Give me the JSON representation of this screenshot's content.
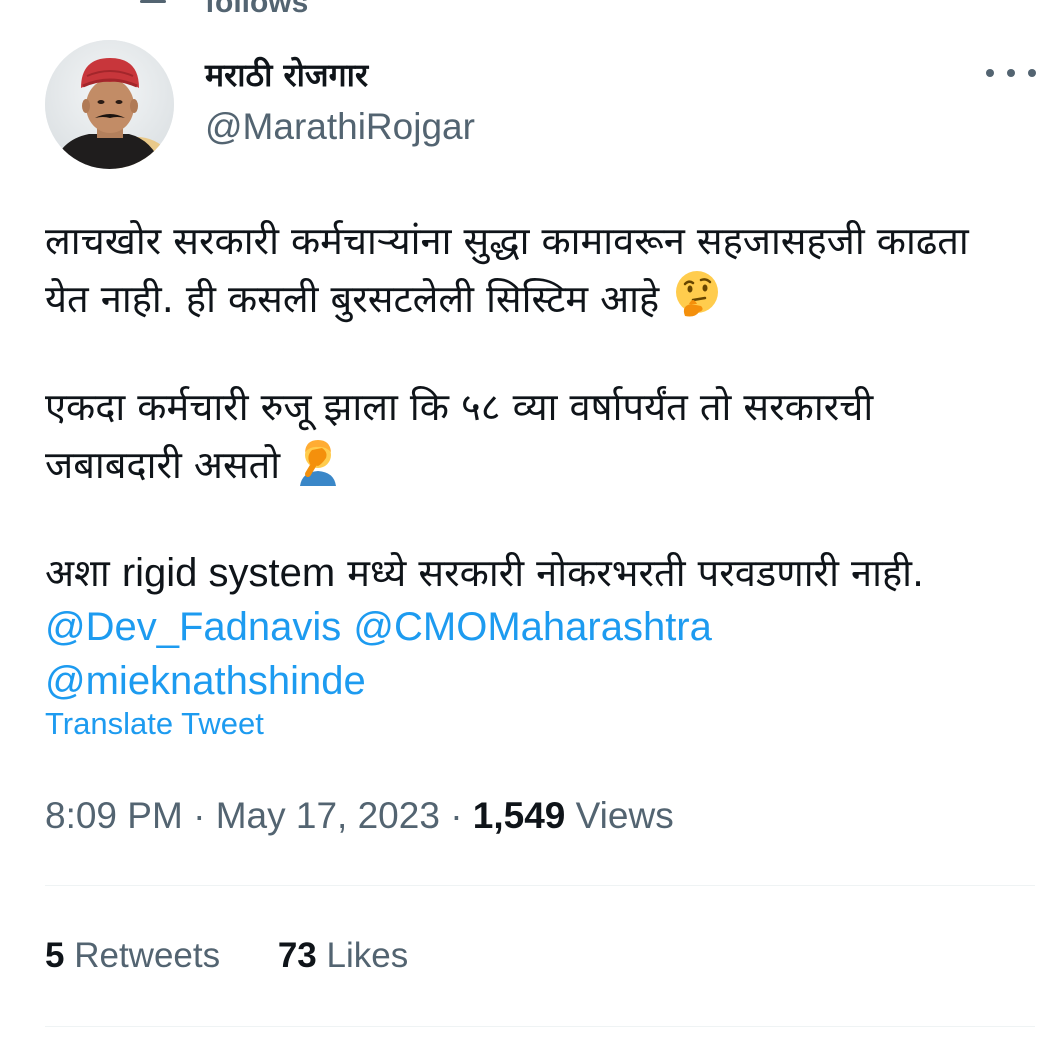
{
  "top_bar": {
    "follows_label": "follows"
  },
  "author": {
    "display_name": "मराठी रोजगार",
    "handle": "@MarathiRojgar",
    "avatar": "avatar-portrait-turban"
  },
  "tweet": {
    "line1": "लाचखोर सरकारी कर्मचाऱ्यांना सुद्धा कामावरून सहजासहजी काढता येत नाही. ही कसली बुरसटलेली सिस्टिम आहे",
    "emoji1": "thinking-face-emoji",
    "line2": "एकदा कर्मचारी रुजू झाला कि ५८ व्या वर्षापर्यंत तो सरकारची जबाबदारी असतो",
    "emoji2": "man-facepalming-emoji",
    "line3_prefix": "अशा",
    "line3_english": "rigid system",
    "line3_rest": "मध्ये सरकारी नोकरभरती परवडणारी नाही.",
    "mentions": [
      "@Dev_Fadnavis",
      "@CMOMaharashtra",
      "@mieknathshinde"
    ]
  },
  "translate_label": "Translate Tweet",
  "meta": {
    "time": "8:09 PM",
    "separator": "·",
    "date": "May 17, 2023",
    "views_count": "1,549",
    "views_label": "Views"
  },
  "stats": {
    "retweets_count": "5",
    "retweets_label": "Retweets",
    "likes_count": "73",
    "likes_label": "Likes"
  },
  "colors": {
    "link": "#1d9bf0",
    "secondary_text": "#536471",
    "primary_text": "#0f1419",
    "divider": "#eff3f4"
  }
}
